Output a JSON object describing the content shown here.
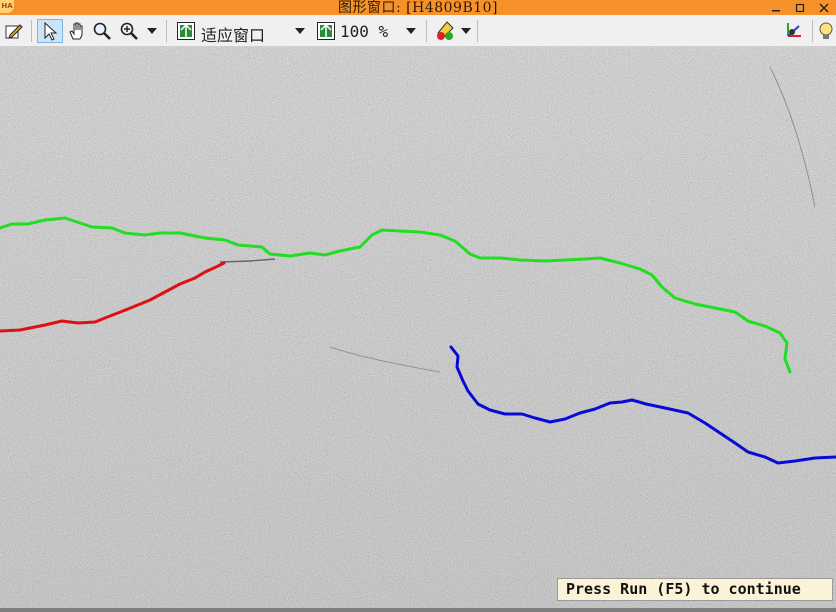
{
  "window": {
    "title": "图形窗口: [H4809B10]",
    "app_badge": "HA",
    "title_color": "#f7922b"
  },
  "toolbar": {
    "icons": [
      "edit-icon",
      "pointer-icon",
      "hand-icon",
      "zoom-icon",
      "zoom-in-icon",
      "dropdown-icon",
      "fit-window-icon",
      "dropdown-icon",
      "zoom-percent-icon",
      "dropdown-icon",
      "color-pick-icon",
      "dropdown-icon",
      "3d-axes-icon",
      "lightbulb-icon"
    ],
    "fit_label": "适应窗口",
    "zoom_label": "100 %"
  },
  "canvas": {
    "background": "asphalt pavement photo",
    "cracks": [
      {
        "name": "green-crack",
        "color": "#22dd22"
      },
      {
        "name": "red-crack",
        "color": "#dd1111"
      },
      {
        "name": "blue-crack",
        "color": "#0a0ad8"
      }
    ]
  },
  "status": {
    "message": "Press Run (F5) to continue"
  }
}
